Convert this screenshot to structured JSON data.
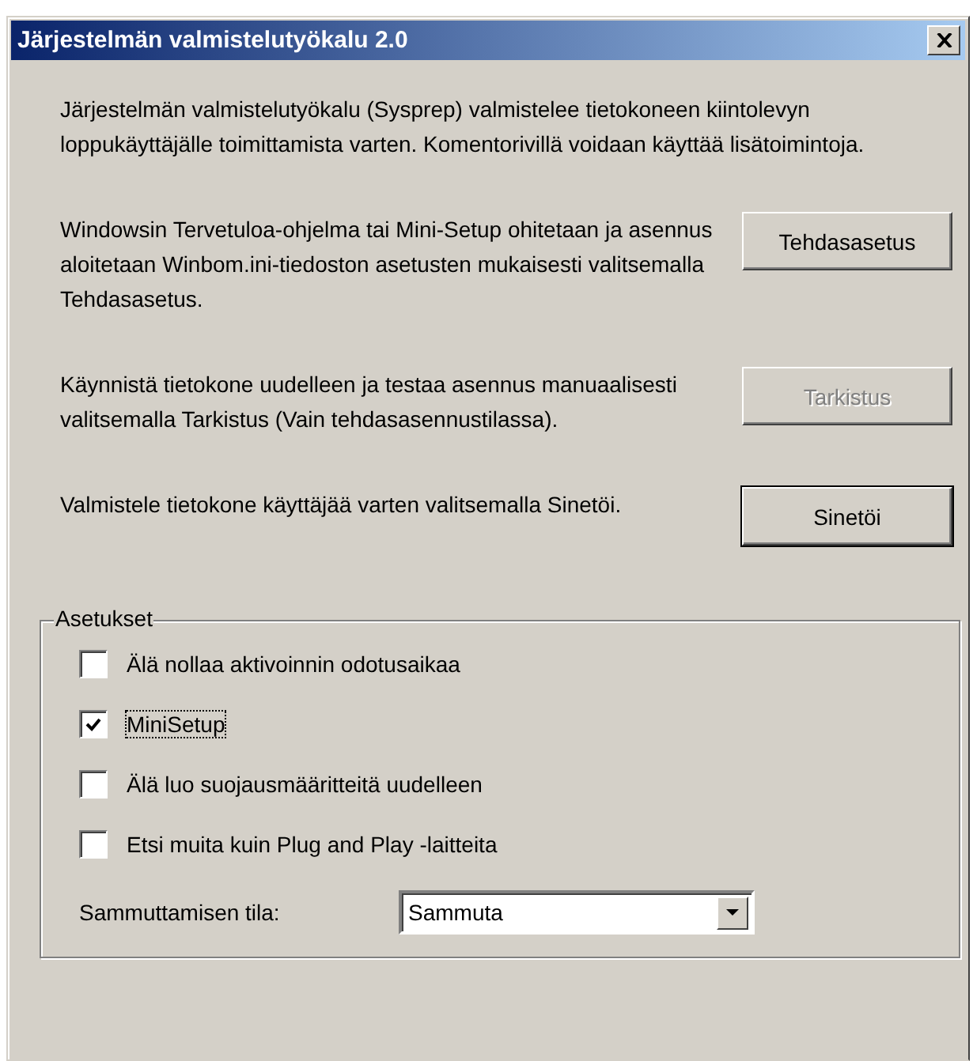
{
  "window": {
    "title": "Järjestelmän valmistelutyökalu 2.0"
  },
  "intro": "Järjestelmän valmistelutyökalu (Sysprep) valmistelee tietokoneen kiintolevyn loppukäyttäjälle toimittamista varten. Komentorivillä voidaan käyttää lisätoimintoja.",
  "sections": [
    {
      "text": "Windowsin Tervetuloa-ohjelma tai Mini-Setup ohitetaan ja asennus aloitetaan Winbom.ini-tiedoston asetusten mukaisesti valitsemalla Tehdasasetus.",
      "button": {
        "label": "Tehdasasetus",
        "disabled": false,
        "default": false
      }
    },
    {
      "text": "Käynnistä tietokone uudelleen ja testaa asennus manuaalisesti valitsemalla Tarkistus (Vain tehdasasennustilassa).",
      "button": {
        "label": "Tarkistus",
        "disabled": true,
        "default": false
      }
    },
    {
      "text": "Valmistele tietokone käyttäjää varten valitsemalla Sinetöi.",
      "button": {
        "label": "Sinetöi",
        "disabled": false,
        "default": true
      }
    }
  ],
  "options": {
    "title": "Asetukset",
    "checkboxes": [
      {
        "label": "Älä nollaa aktivoinnin odotusaikaa",
        "checked": false,
        "focused": false
      },
      {
        "label": "MiniSetup",
        "checked": true,
        "focused": true
      },
      {
        "label": "Älä luo suojausmääritteitä uudelleen",
        "checked": false,
        "focused": false
      },
      {
        "label": "Etsi muita kuin Plug and Play -laitteita",
        "checked": false,
        "focused": false
      }
    ],
    "shutdown": {
      "label": "Sammuttamisen tila:",
      "value": "Sammuta"
    }
  }
}
